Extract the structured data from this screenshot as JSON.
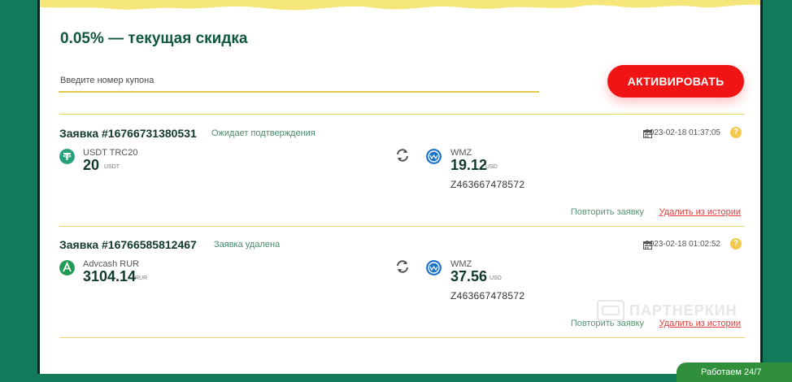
{
  "discount": {
    "text": "0.05% — текущая скидка"
  },
  "coupon": {
    "placeholder": "Введите номер купона",
    "value": ""
  },
  "activate_label": "АКТИВИРОВАТЬ",
  "orders": [
    {
      "id": "Заявка #16766731380531",
      "status": "Ожидает подтверждения",
      "datetime": "2023-02-18 01:37:05",
      "from": {
        "name": "USDT TRC20",
        "amount": "20",
        "currency": "USDT",
        "icon": "tether-icon"
      },
      "to": {
        "name": "WMZ",
        "amount": "19.12",
        "currency": "USD",
        "icon": "webmoney-icon"
      },
      "wallet": "Z463667478572",
      "repeat_label": "Повторить заявку",
      "delete_label": "Удалить из истории"
    },
    {
      "id": "Заявка #16766585812467",
      "status": "Заявка удалена",
      "datetime": "2023-02-18 01:02:52",
      "from": {
        "name": "Advcash RUR",
        "amount": "3104.14",
        "currency": "RUR",
        "icon": "advcash-icon"
      },
      "to": {
        "name": "WMZ",
        "amount": "37.56",
        "currency": "USD",
        "icon": "webmoney-icon"
      },
      "wallet": "Z463667478572",
      "repeat_label": "Повторить заявку",
      "delete_label": "Удалить из истории"
    }
  ],
  "watermark": "ПАРТНЕРКИН",
  "support_tab": "Работаем 24/7",
  "colors": {
    "background": "#137a5c",
    "accent": "#f01414",
    "divider": "#e6d76a",
    "torn_top": "#f5e67a",
    "tether": "#26a17b",
    "advcash": "#1f9b55",
    "webmoney": "#1a73c9"
  }
}
